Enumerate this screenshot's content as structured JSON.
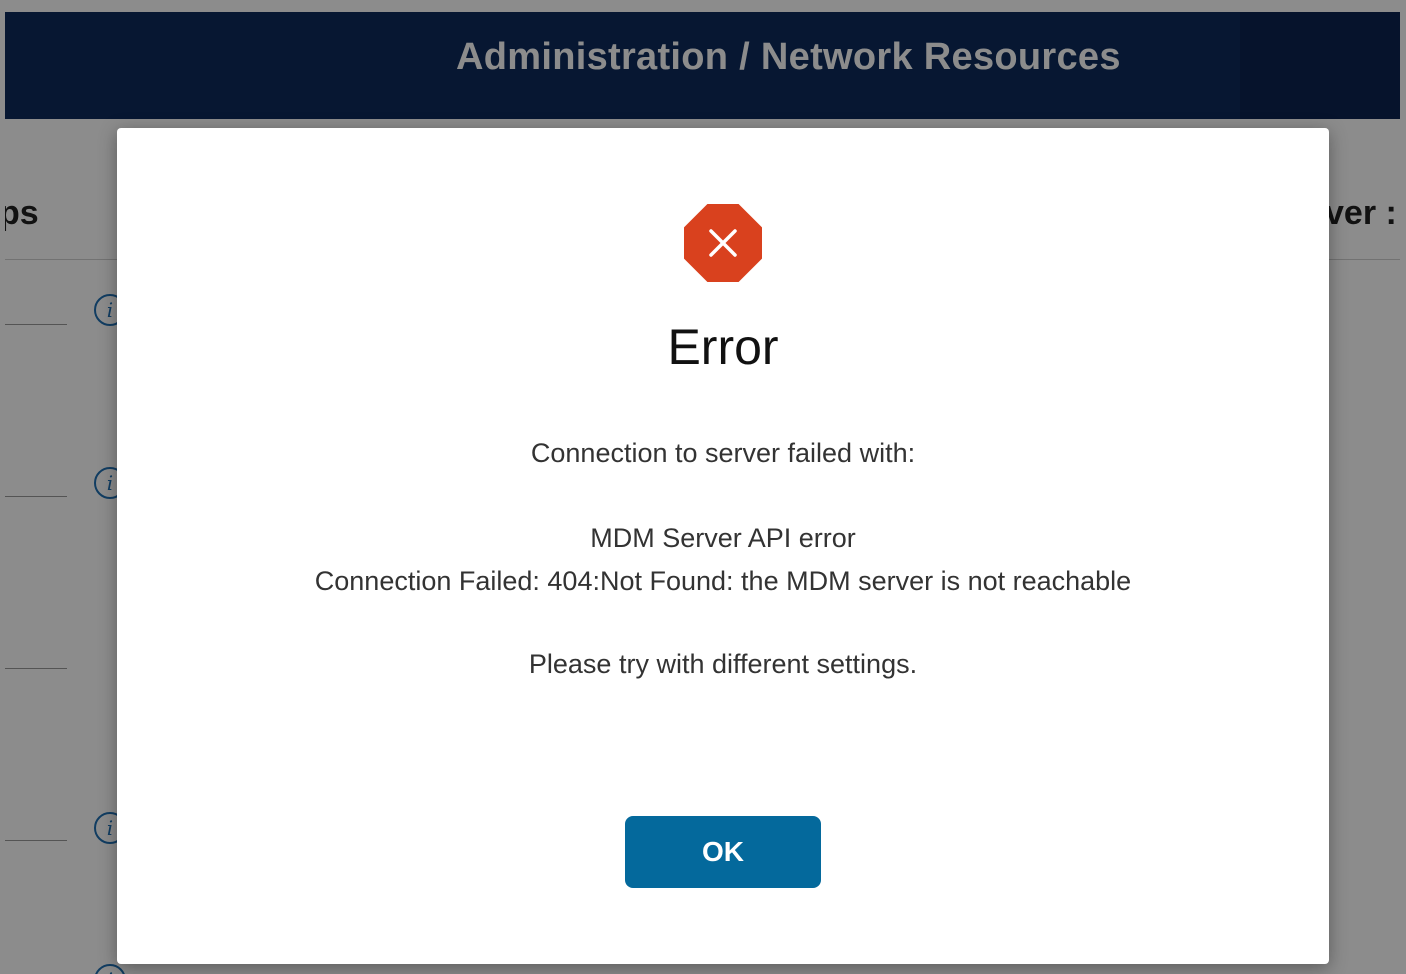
{
  "header": {
    "title": "Administration / Network Resources"
  },
  "background_tabs": {
    "left_fragment": "ps",
    "right_fragment": "ver :"
  },
  "dialog": {
    "title": "Error",
    "icon": "error-octagon-x-icon",
    "message_intro": "Connection to server failed with:",
    "error_title": "MDM Server API error",
    "error_detail": "Connection Failed: 404:Not Found: the MDM server is not reachable",
    "hint": "Please try with different settings.",
    "ok_label": "OK"
  },
  "colors": {
    "header_bg": "#0d2a5b",
    "error_red": "#d9411e",
    "primary_button": "#04699c",
    "info_blue": "#1f6fb2"
  }
}
